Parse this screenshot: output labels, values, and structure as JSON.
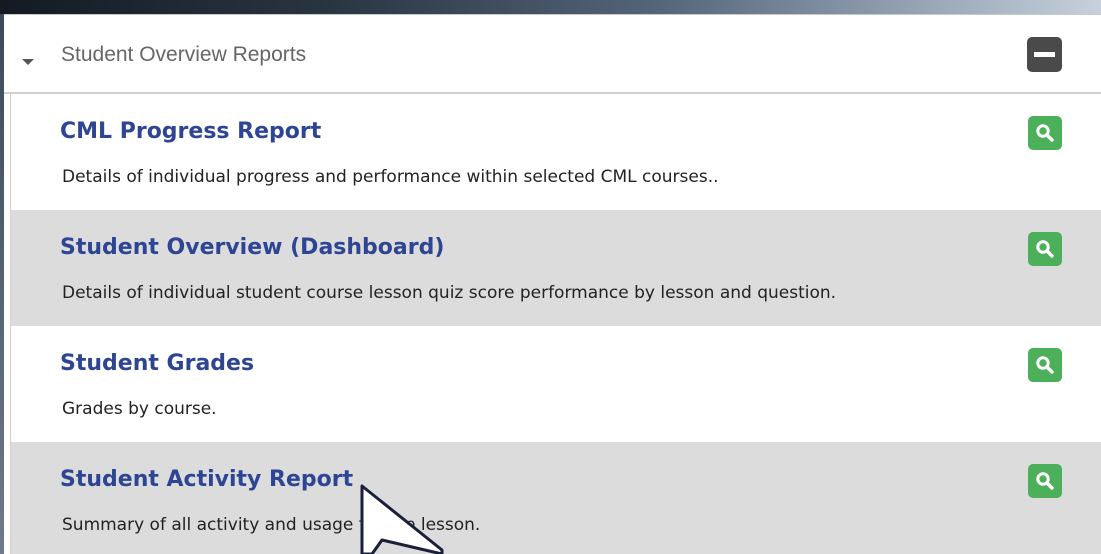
{
  "panel": {
    "title": "Student Overview Reports",
    "collapse_icon": "minus-square-icon"
  },
  "reports": [
    {
      "title": "CML Progress Report",
      "description": "Details of individual progress and performance within selected CML courses..",
      "action_icon": "magnifier-icon"
    },
    {
      "title": "Student Overview (Dashboard)",
      "description": "Details of individual student course lesson quiz score performance by lesson and question.",
      "action_icon": "magnifier-icon"
    },
    {
      "title": "Student Grades",
      "description": "Grades by course.",
      "action_icon": "magnifier-icon"
    },
    {
      "title": "Student Activity Report",
      "description": "Summary of all activity and usage for the lesson.",
      "action_icon": "magnifier-icon"
    }
  ],
  "colors": {
    "link": "#2e4593",
    "action_button": "#4cb05a",
    "row_alt": "#dcdcdc"
  }
}
